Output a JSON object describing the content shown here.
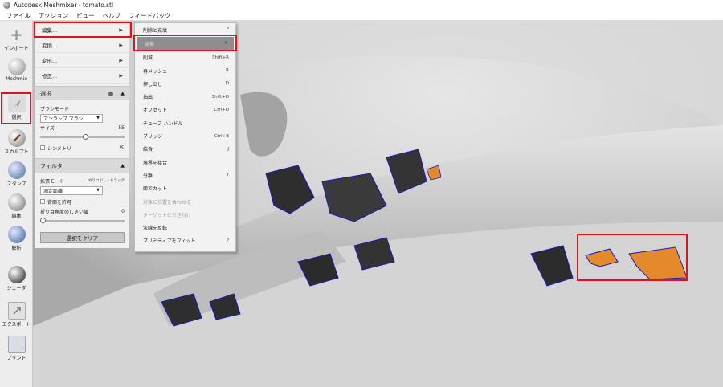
{
  "window": {
    "title": "Autodesk Meshmixer - tomato.stl"
  },
  "menubar": [
    "ファイル",
    "アクション",
    "ビュー",
    "ヘルプ",
    "フィードバック"
  ],
  "toolbar": [
    {
      "name": "import-tool",
      "label": "インポート",
      "icon": "plus-icon"
    },
    {
      "name": "meshmix-tool",
      "label": "Meshmix",
      "icon": "bunny-icon"
    },
    {
      "name": "select-tool",
      "label": "選択",
      "icon": "cursor-icon"
    },
    {
      "name": "sculpt-tool",
      "label": "スカルプト",
      "icon": "brush-icon"
    },
    {
      "name": "stamp-tool",
      "label": "スタンプ",
      "icon": "stamp-icon"
    },
    {
      "name": "edit-tool",
      "label": "編集",
      "icon": "sphere-icon"
    },
    {
      "name": "analysis-tool",
      "label": "解析",
      "icon": "wireframe-icon"
    },
    {
      "name": "shader-tool",
      "label": "シェーダ",
      "icon": "shader-icon"
    },
    {
      "name": "export-tool",
      "label": "エクスポート",
      "icon": "export-icon"
    },
    {
      "name": "print-tool",
      "label": "プリント",
      "icon": "printer-icon"
    }
  ],
  "submenu": {
    "items": [
      {
        "label": "編集...",
        "arrow": "▶"
      },
      {
        "label": "変換...",
        "arrow": "▶"
      },
      {
        "label": "変形...",
        "arrow": "▶"
      },
      {
        "label": "修正...",
        "arrow": "▶"
      }
    ]
  },
  "select_panel": {
    "title": "選択",
    "brush_mode_label": "ブラシモード",
    "brush_mode_value": "アンラップ ブラシ",
    "size_label": "サイズ",
    "size_value": "55",
    "symmetry_label": "シンメトリ"
  },
  "filter_panel": {
    "title": "フィルタ",
    "expand_mode_label": "拡張モード",
    "expand_hint": "ぬりつぶし＋ドラッグ",
    "expand_mode_value": "測定距離",
    "backface_label": "背面を許可",
    "crease_label": "折り目角度のしきい値",
    "crease_value": "0",
    "clear_button": "選択をクリア"
  },
  "dropdown_menu": {
    "items": [
      {
        "label": "削除と充填",
        "shortcut": "F",
        "state": "normal"
      },
      {
        "label": "破棄",
        "shortcut": "X",
        "state": "selected"
      },
      {
        "label": "削減",
        "shortcut": "Shift+R",
        "state": "normal"
      },
      {
        "label": "再メッシュ",
        "shortcut": "R",
        "state": "normal"
      },
      {
        "label": "押し出し",
        "shortcut": "D",
        "state": "normal"
      },
      {
        "label": "抽出",
        "shortcut": "Shift+D",
        "state": "normal"
      },
      {
        "label": "オフセット",
        "shortcut": "Ctrl+D",
        "state": "normal"
      },
      {
        "label": "チューブ ハンドル",
        "shortcut": "",
        "state": "normal"
      },
      {
        "label": "ブリッジ",
        "shortcut": "Ctrl+B",
        "state": "normal"
      },
      {
        "label": "結合",
        "shortcut": "J",
        "state": "normal"
      },
      {
        "label": "境界を接合",
        "shortcut": "",
        "state": "normal"
      },
      {
        "label": "分離",
        "shortcut": "Y",
        "state": "normal"
      },
      {
        "label": "面でカット",
        "shortcut": "",
        "state": "normal"
      },
      {
        "label": "対象に位置を合わせる",
        "shortcut": "",
        "state": "disabled"
      },
      {
        "label": "ターゲットに引き付け",
        "shortcut": "",
        "state": "disabled"
      },
      {
        "label": "法線を反転",
        "shortcut": "",
        "state": "normal"
      },
      {
        "label": "プリミティブをフィット",
        "shortcut": "P",
        "state": "normal"
      }
    ]
  },
  "colors": {
    "highlight": "#e0131a",
    "selection": "#e58a2a",
    "boundary": "#1a1ab8"
  }
}
